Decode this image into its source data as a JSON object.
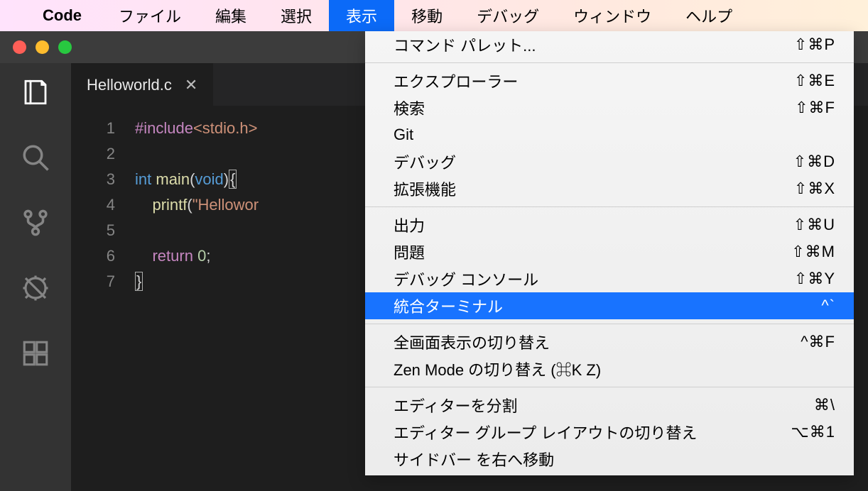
{
  "menubar": {
    "appName": "Code",
    "items": [
      {
        "label": "ファイル"
      },
      {
        "label": "編集"
      },
      {
        "label": "選択"
      },
      {
        "label": "表示",
        "active": true
      },
      {
        "label": "移動"
      },
      {
        "label": "デバッグ"
      },
      {
        "label": "ウィンドウ"
      },
      {
        "label": "ヘルプ"
      }
    ]
  },
  "tab": {
    "filename": "Helloworld.c"
  },
  "code": {
    "lineNumbers": [
      "1",
      "2",
      "3",
      "4",
      "5",
      "6",
      "7"
    ],
    "l1_include": "#include",
    "l1_header": "<stdio.h>",
    "l3_int": "int",
    "l3_main": "main",
    "l3_void": "void",
    "l4_printf": "printf",
    "l4_str": "\"Hellowor",
    "l6_return": "return",
    "l6_zero": "0"
  },
  "dropdown": {
    "groups": [
      [
        {
          "label": "コマンド パレット...",
          "shortcut": "⇧⌘P"
        }
      ],
      [
        {
          "label": "エクスプローラー",
          "shortcut": "⇧⌘E"
        },
        {
          "label": "検索",
          "shortcut": "⇧⌘F"
        },
        {
          "label": "Git",
          "shortcut": ""
        },
        {
          "label": "デバッグ",
          "shortcut": "⇧⌘D"
        },
        {
          "label": "拡張機能",
          "shortcut": "⇧⌘X"
        }
      ],
      [
        {
          "label": "出力",
          "shortcut": "⇧⌘U"
        },
        {
          "label": "問題",
          "shortcut": "⇧⌘M"
        },
        {
          "label": "デバッグ コンソール",
          "shortcut": "⇧⌘Y"
        },
        {
          "label": "統合ターミナル",
          "shortcut": "^`",
          "highlight": true
        }
      ],
      [
        {
          "label": "全画面表示の切り替え",
          "shortcut": "^⌘F"
        },
        {
          "label": "Zen Mode の切り替え (⌘K Z)",
          "shortcut": ""
        }
      ],
      [
        {
          "label": "エディターを分割",
          "shortcut": "⌘\\"
        },
        {
          "label": "エディター グループ レイアウトの切り替え",
          "shortcut": "⌥⌘1"
        },
        {
          "label": "サイドバー を右へ移動",
          "shortcut": ""
        }
      ]
    ]
  }
}
